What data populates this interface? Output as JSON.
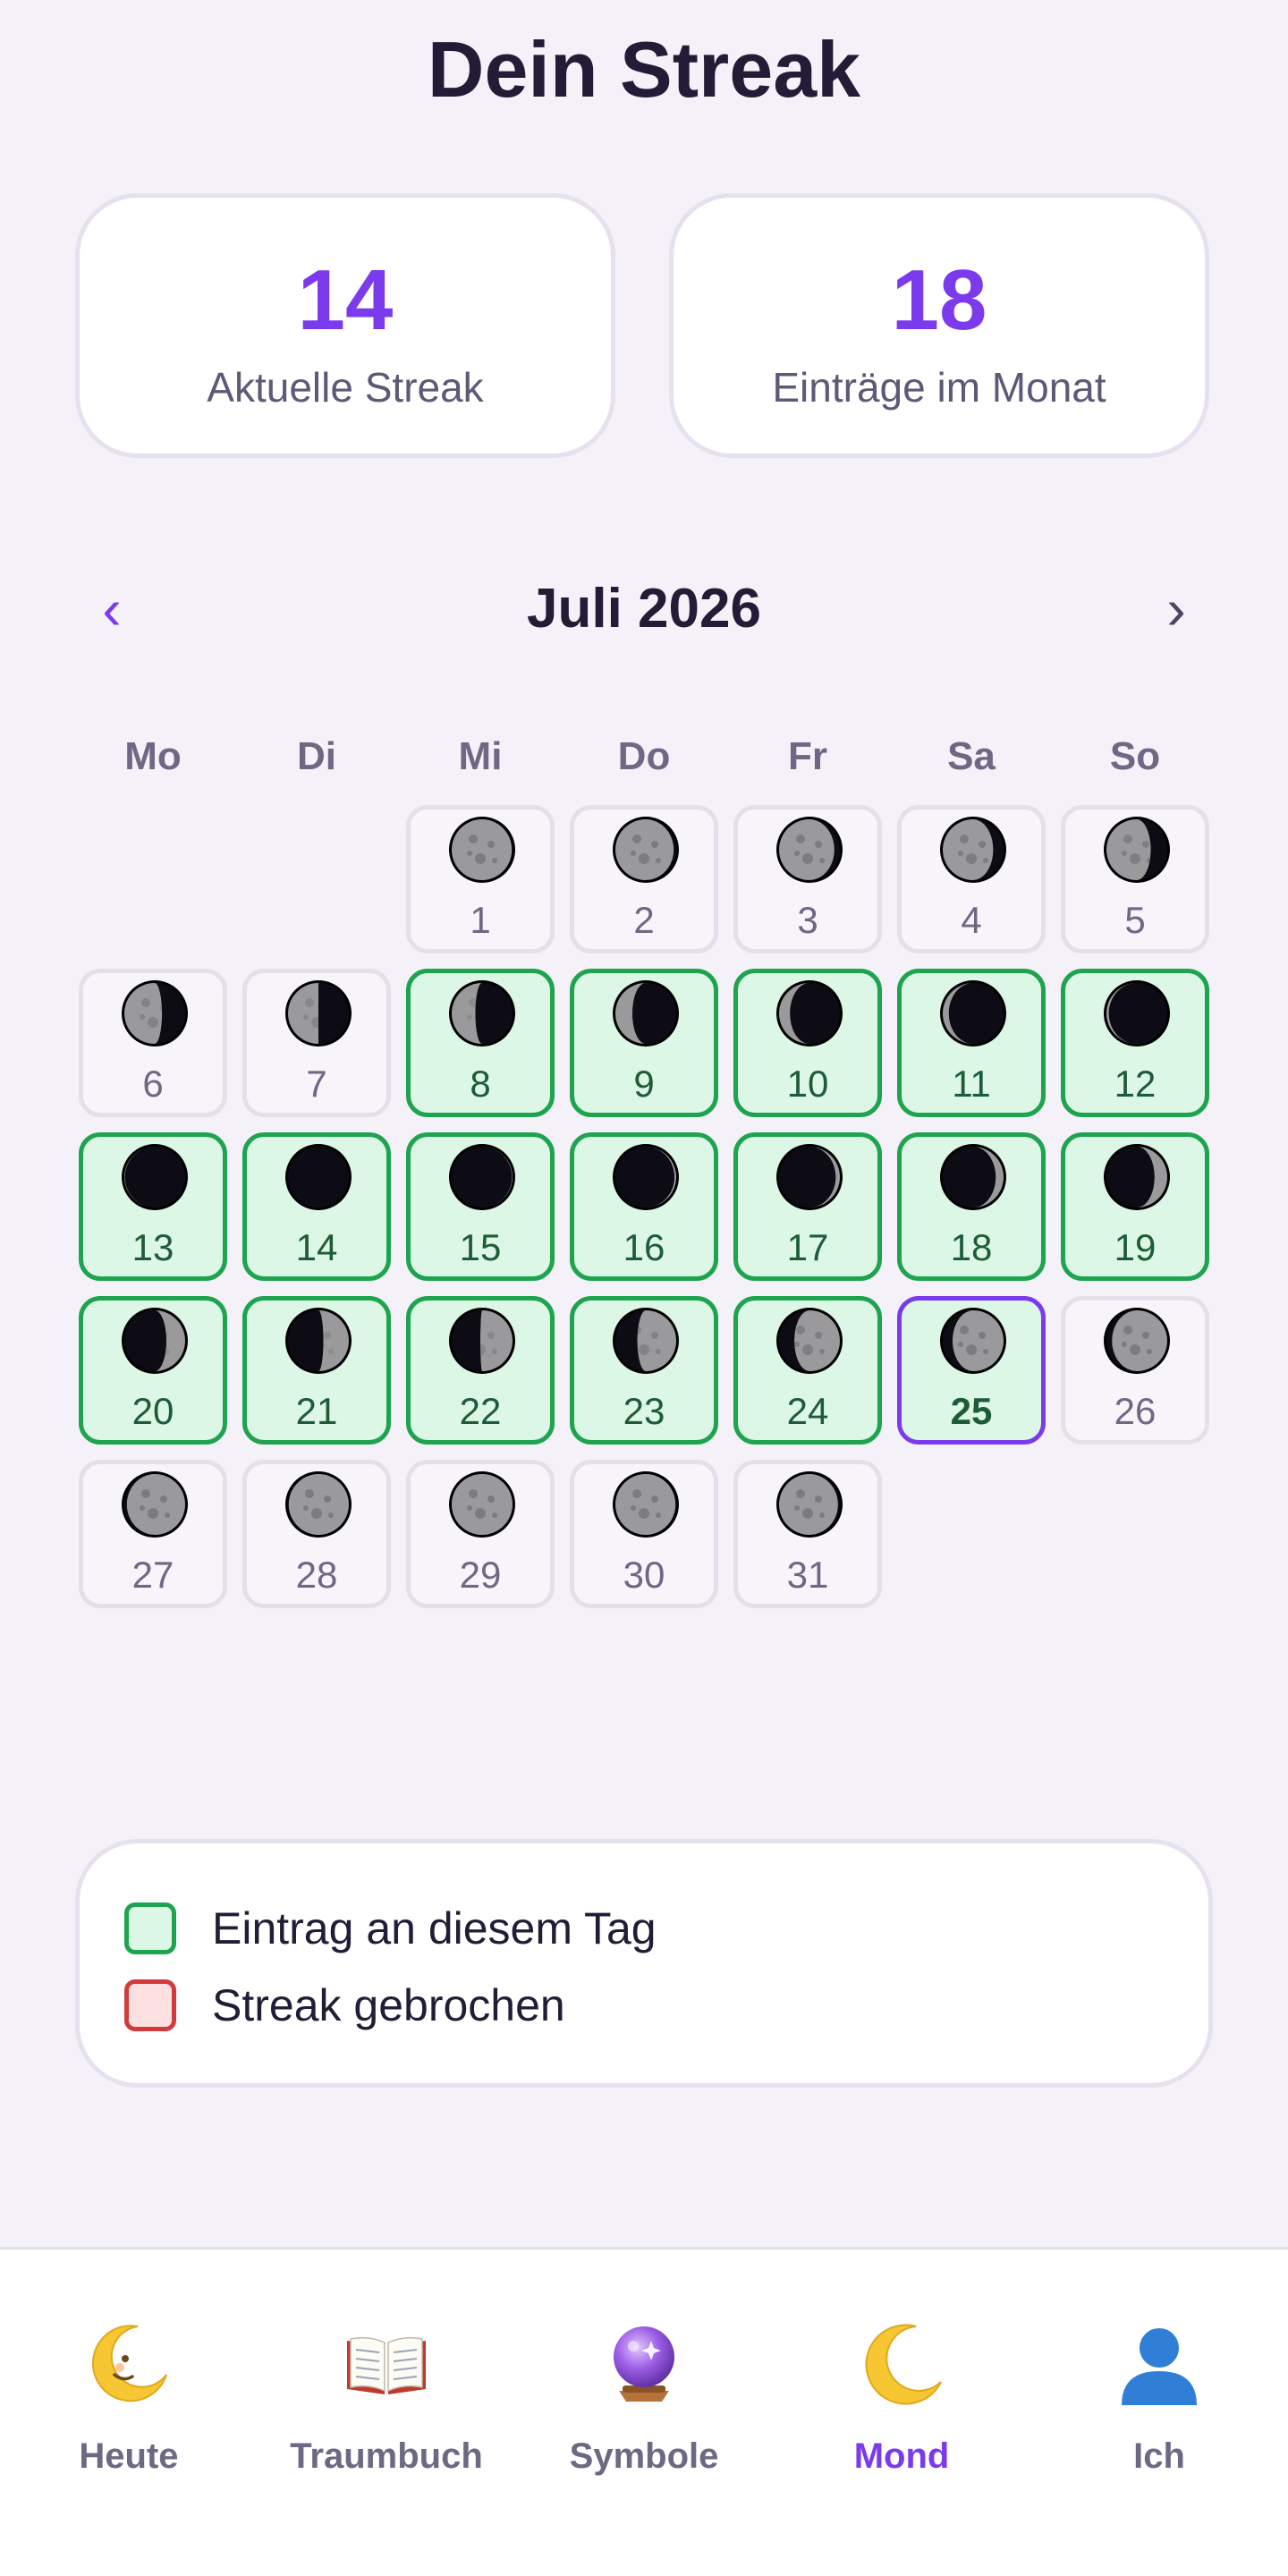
{
  "header": {
    "title": "Dein Streak"
  },
  "stats": [
    {
      "value": "14",
      "label": "Aktuelle Streak"
    },
    {
      "value": "18",
      "label": "Einträge im Monat"
    }
  ],
  "calendar": {
    "month_label": "Juli 2026",
    "prev_symbol": "‹",
    "next_symbol": "›",
    "weekdays": [
      "Mo",
      "Di",
      "Mi",
      "Do",
      "Fr",
      "Sa",
      "So"
    ],
    "first_weekday_index": 2,
    "today": 25,
    "days": [
      {
        "day": "1",
        "status": "none",
        "moon_illumination": 0.99,
        "moon_waxing": false
      },
      {
        "day": "2",
        "status": "none",
        "moon_illumination": 0.96,
        "moon_waxing": false
      },
      {
        "day": "3",
        "status": "none",
        "moon_illumination": 0.91,
        "moon_waxing": false
      },
      {
        "day": "4",
        "status": "none",
        "moon_illumination": 0.83,
        "moon_waxing": false
      },
      {
        "day": "5",
        "status": "none",
        "moon_illumination": 0.73,
        "moon_waxing": false
      },
      {
        "day": "6",
        "status": "none",
        "moon_illumination": 0.62,
        "moon_waxing": false
      },
      {
        "day": "7",
        "status": "none",
        "moon_illumination": 0.5,
        "moon_waxing": false
      },
      {
        "day": "8",
        "status": "entry",
        "moon_illumination": 0.39,
        "moon_waxing": false
      },
      {
        "day": "9",
        "status": "entry",
        "moon_illumination": 0.28,
        "moon_waxing": false
      },
      {
        "day": "10",
        "status": "entry",
        "moon_illumination": 0.18,
        "moon_waxing": false
      },
      {
        "day": "11",
        "status": "entry",
        "moon_illumination": 0.1,
        "moon_waxing": false
      },
      {
        "day": "12",
        "status": "entry",
        "moon_illumination": 0.04,
        "moon_waxing": false
      },
      {
        "day": "13",
        "status": "entry",
        "moon_illumination": 0.01,
        "moon_waxing": false
      },
      {
        "day": "14",
        "status": "entry",
        "moon_illumination": 0.0,
        "moon_waxing": true
      },
      {
        "day": "15",
        "status": "entry",
        "moon_illumination": 0.01,
        "moon_waxing": true
      },
      {
        "day": "16",
        "status": "entry",
        "moon_illumination": 0.03,
        "moon_waxing": true
      },
      {
        "day": "17",
        "status": "entry",
        "moon_illumination": 0.07,
        "moon_waxing": true
      },
      {
        "day": "18",
        "status": "entry",
        "moon_illumination": 0.13,
        "moon_waxing": true
      },
      {
        "day": "19",
        "status": "entry",
        "moon_illumination": 0.21,
        "moon_waxing": true
      },
      {
        "day": "20",
        "status": "entry",
        "moon_illumination": 0.31,
        "moon_waxing": true
      },
      {
        "day": "21",
        "status": "entry",
        "moon_illumination": 0.42,
        "moon_waxing": true
      },
      {
        "day": "22",
        "status": "entry",
        "moon_illumination": 0.53,
        "moon_waxing": true
      },
      {
        "day": "23",
        "status": "entry",
        "moon_illumination": 0.64,
        "moon_waxing": true
      },
      {
        "day": "24",
        "status": "entry",
        "moon_illumination": 0.75,
        "moon_waxing": true
      },
      {
        "day": "25",
        "status": "today",
        "moon_illumination": 0.84,
        "moon_waxing": true
      },
      {
        "day": "26",
        "status": "none",
        "moon_illumination": 0.91,
        "moon_waxing": true
      },
      {
        "day": "27",
        "status": "none",
        "moon_illumination": 0.96,
        "moon_waxing": true
      },
      {
        "day": "28",
        "status": "none",
        "moon_illumination": 0.99,
        "moon_waxing": true
      },
      {
        "day": "29",
        "status": "none",
        "moon_illumination": 1.0,
        "moon_waxing": true
      },
      {
        "day": "30",
        "status": "none",
        "moon_illumination": 0.99,
        "moon_waxing": false
      },
      {
        "day": "31",
        "status": "none",
        "moon_illumination": 0.97,
        "moon_waxing": false
      }
    ]
  },
  "legend": {
    "entry_label": "Eintrag an diesem Tag",
    "broken_label": "Streak gebrochen"
  },
  "bottom_nav": [
    {
      "label": "Heute",
      "icon": "crescent-face-icon",
      "active": false
    },
    {
      "label": "Traumbuch",
      "icon": "open-book-icon",
      "active": false
    },
    {
      "label": "Symbole",
      "icon": "crystal-ball-icon",
      "active": false
    },
    {
      "label": "Mond",
      "icon": "crescent-moon-icon",
      "active": true
    },
    {
      "label": "Ich",
      "icon": "person-icon",
      "active": false
    }
  ],
  "colors": {
    "accent": "#7c3aed",
    "entry_fill": "#dcf7e6",
    "entry_border": "#1ea34e",
    "broken_fill": "#fde0e0",
    "broken_border": "#d13b3b",
    "background": "#f4f1f9"
  }
}
